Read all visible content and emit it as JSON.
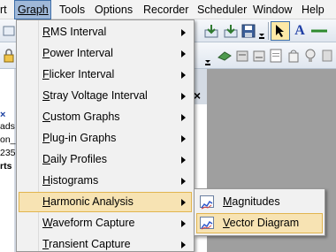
{
  "menubar": {
    "items": [
      {
        "label": "rt"
      },
      {
        "label": "Graph"
      },
      {
        "label": "Tools"
      },
      {
        "label": "Options"
      },
      {
        "label": "Recorder"
      },
      {
        "label": "Scheduler"
      },
      {
        "label": "Window"
      },
      {
        "label": "Help"
      }
    ]
  },
  "graph_menu": {
    "items": [
      {
        "label_u": "R",
        "label_rest": "MS Interval"
      },
      {
        "label_u": "P",
        "label_rest": "ower Interval"
      },
      {
        "label_u": "F",
        "label_rest": "licker Interval"
      },
      {
        "label_u": "S",
        "label_rest": "tray Voltage Interval"
      },
      {
        "label_u": "C",
        "label_rest": "ustom Graphs"
      },
      {
        "label_u": "P",
        "label_rest": "lug-in Graphs"
      },
      {
        "label_u": "D",
        "label_rest": "aily Profiles"
      },
      {
        "label_u": "H",
        "label_rest": "istograms"
      },
      {
        "label_u": "H",
        "label_rest": "armonic Analysis"
      },
      {
        "label_u": "W",
        "label_rest": "aveform Capture"
      },
      {
        "label_u": "T",
        "label_rest": "ransient Capture"
      }
    ]
  },
  "harmonic_submenu": {
    "items": [
      {
        "label_u": "M",
        "label_rest": "agnitudes"
      },
      {
        "label_u": "V",
        "label_rest": "ector Diagram"
      }
    ]
  },
  "left_panel": {
    "lines": [
      "ads",
      "on_",
      "235",
      "rts"
    ]
  },
  "panel_close": "×"
}
